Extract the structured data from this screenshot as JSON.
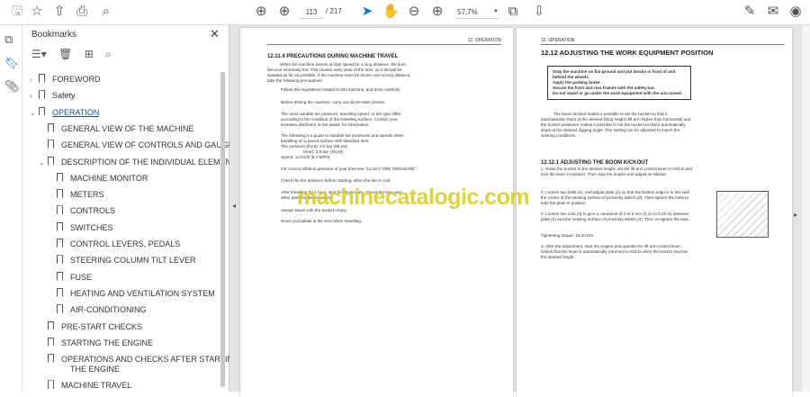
{
  "toolbar": {
    "page_current": "113",
    "page_total": "/ 217",
    "zoom": "57,7%"
  },
  "bookmarks": {
    "title": "Bookmarks",
    "items": [
      {
        "label": "FOREWORD",
        "level": 0,
        "expand": "›"
      },
      {
        "label": "Safety",
        "level": 0,
        "expand": "›"
      },
      {
        "label": "OPERATION",
        "level": 0,
        "expand": "⌄",
        "link": true
      },
      {
        "label": "GENERAL VIEW OF THE MACHINE",
        "level": 1,
        "expand": ""
      },
      {
        "label": "GENERAL VIEW OF CONTROLS AND GAUGES",
        "level": 1,
        "expand": ""
      },
      {
        "label": "DESCRIPTION OF THE INDIVIDUAL ELEMENTS",
        "level": 1,
        "expand": "⌄"
      },
      {
        "label": "MACHINE MONITOR",
        "level": 2,
        "expand": ""
      },
      {
        "label": "METERS",
        "level": 2,
        "expand": ""
      },
      {
        "label": "CONTROLS",
        "level": 2,
        "expand": ""
      },
      {
        "label": "SWITCHES",
        "level": 2,
        "expand": ""
      },
      {
        "label": "CONTROL LEVERS, PEDALS",
        "level": 2,
        "expand": ""
      },
      {
        "label": "STEERING COLUMN TILT LEVER",
        "level": 2,
        "expand": ""
      },
      {
        "label": "FUSE",
        "level": 2,
        "expand": ""
      },
      {
        "label": "HEATING AND VENTILATION SYSTEM",
        "level": 2,
        "expand": ""
      },
      {
        "label": "AIR-CONDITIONING",
        "level": 2,
        "expand": ""
      },
      {
        "label": "PRE-START CHECKS",
        "level": 1,
        "expand": ""
      },
      {
        "label": "STARTING THE ENGINE",
        "level": 1,
        "expand": ""
      },
      {
        "label": "OPERATIONS AND CHECKS AFTER STARTING",
        "label2": "THE ENGINE",
        "level": 1,
        "expand": ""
      },
      {
        "label": "MACHINE TRAVEL",
        "level": 1,
        "expand": ""
      }
    ]
  },
  "left_page": {
    "header": "12. OPERATION",
    "title": "12.11.4      PRECAUTIONS DURING MACHINE TRAVEL",
    "intro": "When the machine travels at high speed for a long distance, the tires become extremely hot. This causes early wear of the tires, so it should be avoided as far as possible. If the machine must be driven over a long distance, take the following precautions:",
    "b1": "Follow the regulations related to this machine, and drive carefully.",
    "b2": "Before driving the machine, carry out all pre-start checks.",
    "b3": "The most suitable tire pressure, travelling speed, or tire type differ according to the condition of the travelling surface. Contact your Komatsu distributor or tire dealer for information.",
    "b4": "The following is a guide to suitable tire pressures and speeds when travelling on a paved surface with standard tires:",
    "p1": "The pressure (front):        3.5 bar  (58 psi)",
    "p2": "(rear):        3.5 bar  (46 psi)",
    "speed": "Speed: 14 km/h (8.7 MPH).",
    "ref": "For correct inflation pressure of your tires see \"12.18.2 TIRE PRESSURE\".",
    "b5": "Check the tire pressure before starting, when the tire is cool.",
    "b6": "After travelling for 1 hour, stop for 30 minutes. Check the tires and other parts for abnormalities.",
    "b7": "Always travel with the bucket empty.",
    "b8": "Never put ballast in the tires when travelling."
  },
  "right_page": {
    "header": "12. OPERATION",
    "title": "12.12      ADJUSTING THE WORK EQUIPMENT POSITION",
    "warnings": [
      "Stop the machine on flat ground and put blocks in front of and behind the wheels.",
      "Apply the parking brake.",
      "Secure the front and rear frames with the safety bar.",
      "Do not stand or go under the work equipment with the arm raised."
    ],
    "intro": "The boom kickout makes it possible to set the bucket so that it automatically stops at the desired lifting height (lift arm higher than horizontal) and the bucket positioner makes it possible to set the bucket so that it automatically stops at the desired digging angle. The setting can be adjusted to match the working conditions.",
    "subtitle": "12.12.1      ADJUSTING THE BOOM KICKOUT",
    "s1": "1.    Raise the bucket to the desired height, set the lift arm control lever to HOLD and lock the lever in position. Then stop the engine and adjust as follows:",
    "s2": "2.    Loosen two bolts (1), and adjust plate (2) so that the bottom edge is in line with the center of the sensing surface of proximity switch (3). Then tighten the bolts to hold the plate in position.",
    "s3": "3.    Loosen two nuts (4) to give a clearance of 3 to 5 mm (0.12 to 0.20 in) between plate (2) and the sensing surface of proximity switch (3). Then re-tighten the nuts.",
    "torque": "Tightening torque: 15-20 Nm.",
    "s4": "4.    After the adjustment, start the engine and operate the lift arm control lever. Check that the lever is automatically returned to HOLD when the bucket reaches the desired height."
  },
  "watermark": "machinecatalogic.com"
}
